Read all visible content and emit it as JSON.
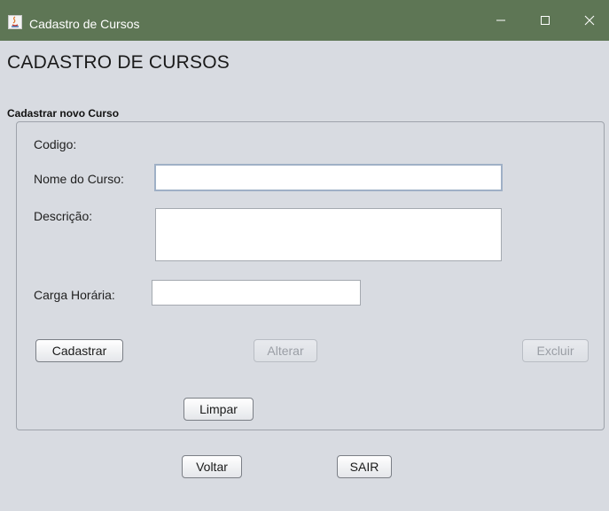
{
  "window": {
    "title": "Cadastro de Cursos",
    "controls": [
      "minimize-icon",
      "maximize-icon",
      "close-icon"
    ]
  },
  "form": {
    "heading": "CADASTRO DE CURSOS",
    "section_title": "Cadastrar novo Curso",
    "codigo_label": "Codigo:",
    "nome_label": "Nome do Curso:",
    "nome_value": "",
    "descricao_label": "Descrição:",
    "descricao_value": "",
    "carga_label": "Carga Horária:",
    "carga_value": ""
  },
  "buttons": {
    "cadastrar": "Cadastrar",
    "alterar": "Alterar",
    "excluir": "Excluir",
    "limpar": "Limpar",
    "voltar": "Voltar",
    "sair": "SAIR"
  },
  "colors": {
    "titlebar": "#5e7655",
    "background": "#d8dbe1"
  }
}
